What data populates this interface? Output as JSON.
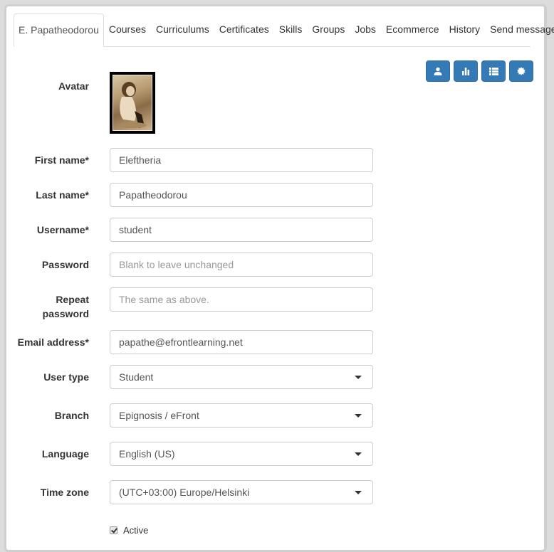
{
  "tabs": [
    {
      "label": "E. Papatheodorou",
      "active": true
    },
    {
      "label": "Courses",
      "active": false
    },
    {
      "label": "Curriculums",
      "active": false
    },
    {
      "label": "Certificates",
      "active": false
    },
    {
      "label": "Skills",
      "active": false
    },
    {
      "label": "Groups",
      "active": false
    },
    {
      "label": "Jobs",
      "active": false
    },
    {
      "label": "Ecommerce",
      "active": false
    },
    {
      "label": "History",
      "active": false
    },
    {
      "label": "Send message",
      "active": false
    }
  ],
  "actions": [
    {
      "icon": "user-icon"
    },
    {
      "icon": "bar-chart-icon"
    },
    {
      "icon": "list-icon"
    },
    {
      "icon": "certificate-icon"
    }
  ],
  "accent_color": "#337ab7",
  "form": {
    "avatar_label": "Avatar",
    "first_name": {
      "label": "First name*",
      "value": "Eleftheria"
    },
    "last_name": {
      "label": "Last name*",
      "value": "Papatheodorou"
    },
    "username": {
      "label": "Username*",
      "value": "student"
    },
    "password": {
      "label": "Password",
      "value": "",
      "placeholder": "Blank to leave unchanged"
    },
    "repeat_password": {
      "label_line1": "Repeat",
      "label_line2": "password",
      "value": "",
      "placeholder": "The same as above."
    },
    "email": {
      "label": "Email address*",
      "value": "papathe@efrontlearning.net"
    },
    "user_type": {
      "label": "User type",
      "value": "Student"
    },
    "branch": {
      "label": "Branch",
      "value": "Epignosis / eFront"
    },
    "language": {
      "label": "Language",
      "value": "English (US)"
    },
    "time_zone": {
      "label": "Time zone",
      "value": "(UTC+03:00) Europe/Helsinki"
    },
    "active": {
      "label": "Active",
      "checked": true
    }
  }
}
